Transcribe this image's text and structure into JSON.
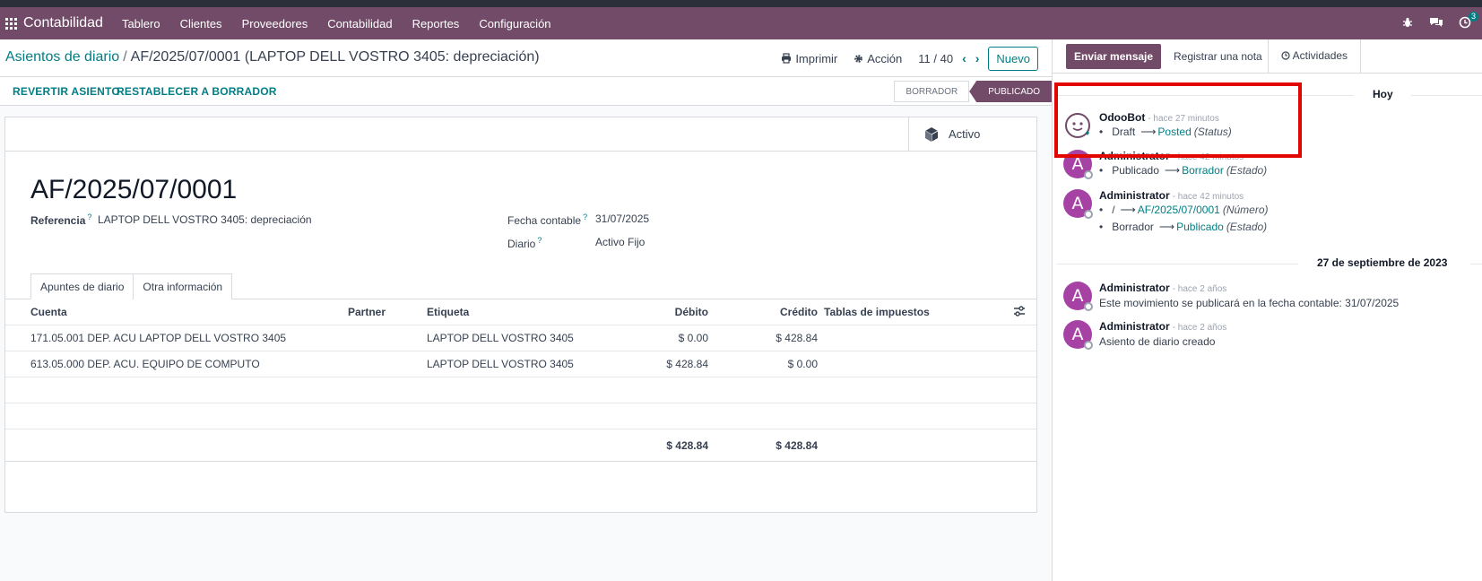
{
  "navbar": {
    "brand": "Contabilidad",
    "items": [
      "Tablero",
      "Clientes",
      "Proveedores",
      "Contabilidad",
      "Reportes",
      "Configuración"
    ],
    "activity_count": "3"
  },
  "breadcrumb": {
    "parent": "Asientos de diario",
    "separator": "/",
    "current": "AF/2025/07/0001 (LAPTOP DELL VOSTRO 3405: depreciación)"
  },
  "toolbar": {
    "print_label": "Imprimir",
    "action_label": "Acción",
    "pager": "11 / 40",
    "new_label": "Nuevo"
  },
  "statusbar": {
    "revert_label": "REVERTIR ASIENTO",
    "reset_label": "RESTABLECER A BORRADOR",
    "stages": [
      "BORRADOR",
      "PUBLICADO"
    ],
    "active_stage": "PUBLICADO"
  },
  "sheet": {
    "smart_button": "Activo",
    "title": "AF/2025/07/0001",
    "referencia_label": "Referencia",
    "referencia_value": "LAPTOP DELL VOSTRO 3405: depreciación",
    "fecha_label": "Fecha contable",
    "fecha_value": "31/07/2025",
    "diario_label": "Diario",
    "diario_value": "Activo Fijo",
    "help_mark": "?",
    "tabs": [
      "Apuntes de diario",
      "Otra información"
    ]
  },
  "lines": {
    "headers": [
      "Cuenta",
      "Partner",
      "Etiqueta",
      "Débito",
      "Crédito",
      "Tablas de impuestos"
    ],
    "rows": [
      {
        "cuenta": "171.05.001 DEP. ACU LAPTOP DELL VOSTRO 3405",
        "partner": "",
        "etiqueta": "LAPTOP DELL VOSTRO 3405",
        "debito": "$ 0.00",
        "credito": "$ 428.84"
      },
      {
        "cuenta": "613.05.000 DEP. ACU. EQUIPO DE COMPUTO",
        "partner": "",
        "etiqueta": "LAPTOP DELL VOSTRO 3405",
        "debito": "$ 428.84",
        "credito": "$ 0.00"
      }
    ],
    "total_debito": "$ 428.84",
    "total_credito": "$ 428.84"
  },
  "chatter": {
    "send_label": "Enviar mensaje",
    "note_label": "Registrar una nota",
    "activities_label": "Actividades",
    "date_today": "Hoy",
    "date_old": "27 de septiembre de 2023",
    "messages": [
      {
        "author": "OdooBot",
        "time": "- hace 27 minutos",
        "tracks": [
          {
            "from": "Draft",
            "to": "Posted",
            "field": "(Status)"
          }
        ]
      },
      {
        "author": "Administrator",
        "time": "- hace 42 minutos",
        "tracks": [
          {
            "from": "Publicado",
            "to": "Borrador",
            "field": "(Estado)"
          }
        ]
      },
      {
        "author": "Administrator",
        "time": "- hace 42 minutos",
        "tracks": [
          {
            "from": "/",
            "to": "AF/2025/07/0001",
            "field": "(Número)"
          },
          {
            "from": "Borrador",
            "to": "Publicado",
            "field": "(Estado)"
          }
        ]
      },
      {
        "author": "Administrator",
        "time": "- hace 2 años",
        "body": "Este movimiento se publicará en la fecha contable: 31/07/2025"
      },
      {
        "author": "Administrator",
        "time": "- hace 2 años",
        "body": "Asiento de diario creado"
      }
    ],
    "avatar_letter": "A",
    "bullet": "•",
    "arrow": "⟶"
  },
  "colors": {
    "brand": "#714b67",
    "accent": "#017e84",
    "highlight": "#e10600"
  }
}
